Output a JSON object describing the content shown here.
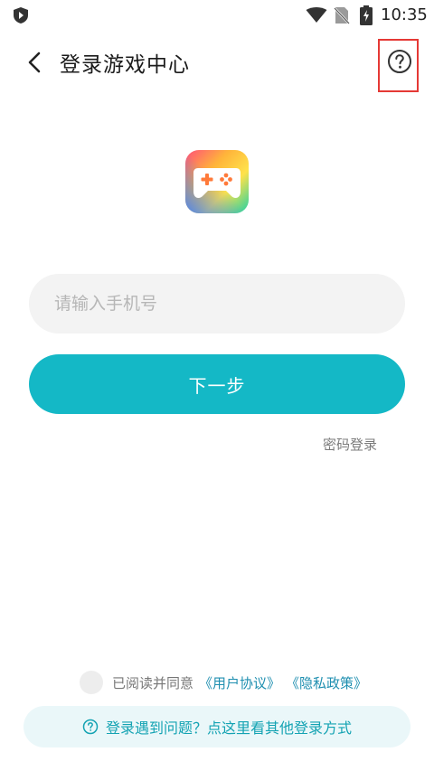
{
  "status_bar": {
    "time": "10:35",
    "icons": [
      "shield-icon",
      "wifi-icon",
      "no-sim-icon",
      "battery-charging-icon"
    ]
  },
  "header": {
    "title": "登录游戏中心",
    "back_icon": "chevron-left-icon",
    "help_icon": "question-circle-icon"
  },
  "logo": {
    "icon": "gamepad-icon"
  },
  "phone_input": {
    "placeholder": "请输入手机号",
    "value": ""
  },
  "next_button": {
    "label": "下一步"
  },
  "password_login": {
    "label": "密码登录"
  },
  "agreement": {
    "checked": false,
    "text": "已阅读并同意",
    "user_agreement": "《用户协议》",
    "privacy_policy": "《隐私政策》"
  },
  "help_bar": {
    "label": "登录遇到问题？点这里看其他登录方式"
  },
  "colors": {
    "accent": "#14b8c6",
    "link": "#1f8fb0",
    "highlight_frame": "#e53935"
  }
}
